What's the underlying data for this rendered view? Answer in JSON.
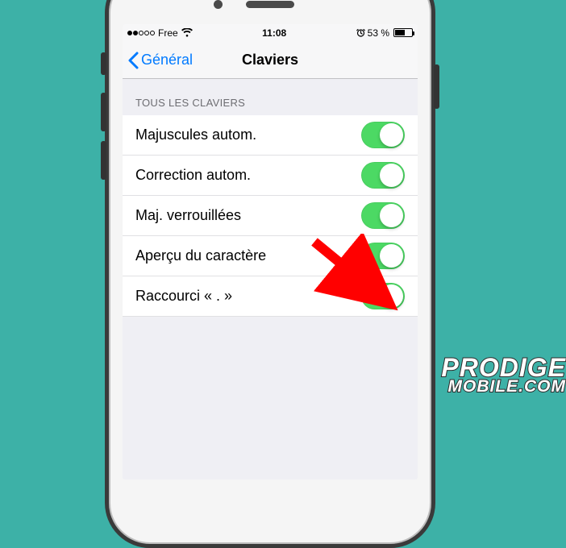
{
  "status": {
    "carrier": "Free",
    "time": "11:08",
    "battery_pct": "53 %",
    "signal_filled": 2,
    "signal_total": 5
  },
  "nav": {
    "back_label": "Général",
    "title": "Claviers"
  },
  "section": {
    "header": "TOUS LES CLAVIERS"
  },
  "rows": [
    {
      "label": "Majuscules autom.",
      "on": true
    },
    {
      "label": "Correction autom.",
      "on": true
    },
    {
      "label": "Maj. verrouillées",
      "on": true
    },
    {
      "label": "Aperçu du caractère",
      "on": true
    },
    {
      "label": "Raccourci « . »",
      "on": true
    }
  ],
  "watermark": {
    "line1": "PRODIGE",
    "line2": "MOBILE.COM"
  },
  "colors": {
    "accent": "#007aff",
    "toggle_on": "#4cd964",
    "arrow": "#ff0000",
    "bg": "#3db1a7"
  }
}
